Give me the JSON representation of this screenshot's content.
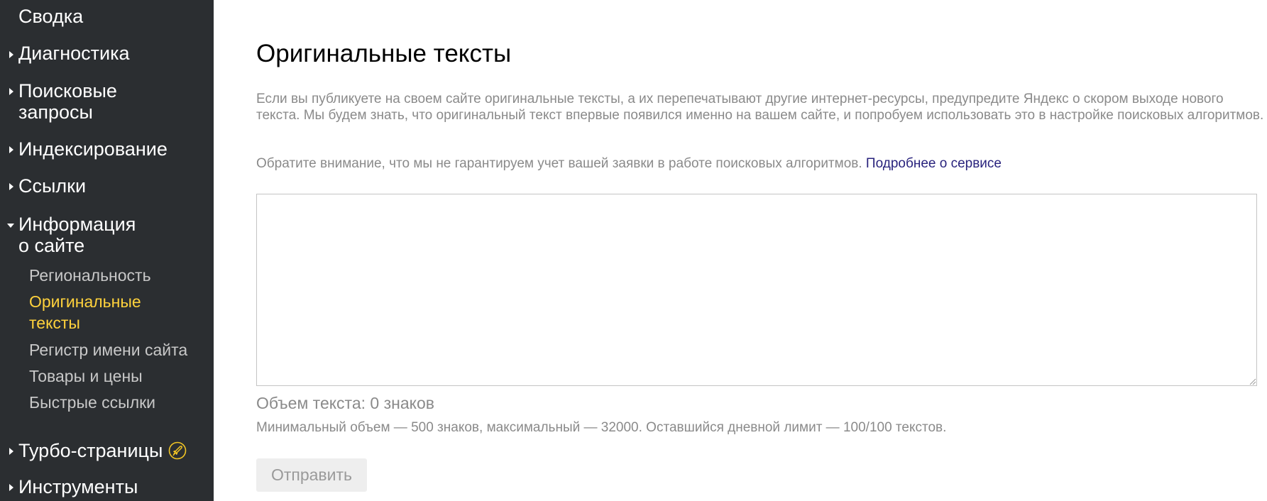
{
  "sidebar": {
    "items": [
      {
        "label": "Сводка"
      },
      {
        "label": "Диагностика"
      },
      {
        "label": "Поисковые\nзапросы"
      },
      {
        "label": "Индексирование"
      },
      {
        "label": "Ссылки"
      },
      {
        "label": "Информация\nо сайте"
      },
      {
        "label": "Турбо-страницы"
      },
      {
        "label": "Инструменты"
      }
    ],
    "site_info_subitems": [
      {
        "label": "Региональность"
      },
      {
        "label": "Оригинальные\nтексты"
      },
      {
        "label": "Регистр имени сайта"
      },
      {
        "label": "Товары и цены"
      },
      {
        "label": "Быстрые ссылки"
      }
    ],
    "active_color": "#ffd23c",
    "turbo_icon": "rocket-icon"
  },
  "main": {
    "title": "Оригинальные тексты",
    "description": "Если вы публикуете на своем сайте оригинальные тексты, а их перепечатывают другие интернет-ресурсы, предупредите Яндекс о скором выходе нового текста. Мы будем знать, что оригинальный текст впервые появился именно на вашем сайте, и попробуем использовать это в настройке поисковых алгоритмов.",
    "note": "Обратите внимание, что мы не гарантируем учет вашей заявки в работе поисковых алгоритмов.",
    "more_link": "Подробнее о сервисе",
    "textarea_value": "",
    "counter": "Объем текста: 0 знаков",
    "limits": "Минимальный объем — 500 знаков, максимальный — 32000. Оставшийся дневной лимит — 100/100 текстов.",
    "submit_label": "Отправить",
    "link_color": "#29237d"
  }
}
